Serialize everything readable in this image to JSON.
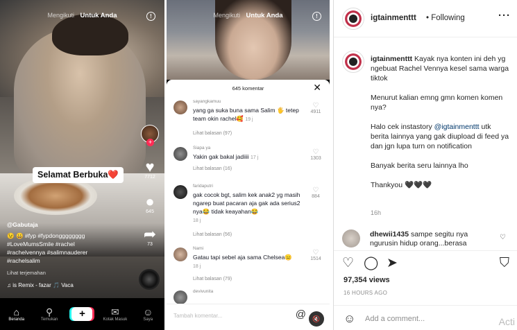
{
  "tiktok_left": {
    "tabs": {
      "following": "Mengikuti",
      "foryou": "Untuk Anda"
    },
    "overlay_caption": "Selamat Berbuka❤️",
    "like_count": "7712",
    "comment_count": "645",
    "share_count": "73",
    "username": "@Gabutaja",
    "caption_lines": [
      "😉 😀 #fyp #fypdongggggggg",
      "#LoveMumsSmile #rachel",
      "#rachelvennya #salimnauderer",
      "#rachelsalim"
    ],
    "translate": "Lihat terjemahan",
    "music": "♫ is Remix - fazar 🎵   Vaca",
    "nav": [
      "Beranda",
      "Temukan",
      "+",
      "Kotak Masuk",
      "Saya"
    ]
  },
  "tiktok_mid": {
    "tabs": {
      "following": "Mengikuti",
      "foryou": "Untuk Anda"
    },
    "comments_title": "645 komentar",
    "comments": [
      {
        "user": "sayangkamuu",
        "text": "yang ga suka buna sama Salim 🖐 tetep team okin rachel🥰",
        "time": "19 j",
        "replies": "Lihat balasan (97)",
        "likes": "4911"
      },
      {
        "user": "Siapa ya",
        "text": "Yakin gak bakal jadiiii",
        "time": "17 j",
        "replies": "Lihat balasan (16)",
        "likes": "1303"
      },
      {
        "user": "faridaputri",
        "text": "gak cocok bgt, salim kek anak2 yg masih ngarep buat pacaran aja gak ada serius2 nya😂 tidak keayahan😂",
        "time": "18 j",
        "replies": "Lihat balasan (56)",
        "likes": "884"
      },
      {
        "user": "Nami",
        "text": "Gatau tapi sebel aja sama Chelsea😑",
        "time": "18 j",
        "replies": "Lihat balasan (79)",
        "likes": "1514"
      },
      {
        "user": "devivunita",
        "text": "",
        "time": "",
        "replies": "",
        "likes": ""
      }
    ],
    "input_placeholder": "Tambah komentar..."
  },
  "instagram": {
    "username": "igtainmenttt",
    "follow_status": "• Following",
    "caption_p1_rest": " Kayak nya konten ini deh yg ngebuat Rachel Vennya kesel sama warga tiktok",
    "caption_p2": "Menurut kalian emng gmn komen komen nya?",
    "caption_p3_pre": "Halo cek instastory ",
    "caption_p3_mention": "@igtainmenttt",
    "caption_p3_post": " utk berita lainnya yang gak diupload di feed ya dan jgn lupa turn on notification",
    "caption_p4": "Banyak berita seru lainnya lho",
    "caption_p5": "Thankyou 🖤🖤🖤",
    "caption_time": "16h",
    "comment2_user": "dhewii1435",
    "comment2_text": " sampe segitu nya ngurusin hidup orang...berasa",
    "views": "97,354 views",
    "time_ago": "16 HOURS AGO",
    "add_comment_placeholder": "Add a comment...",
    "watermark": "Acti"
  }
}
